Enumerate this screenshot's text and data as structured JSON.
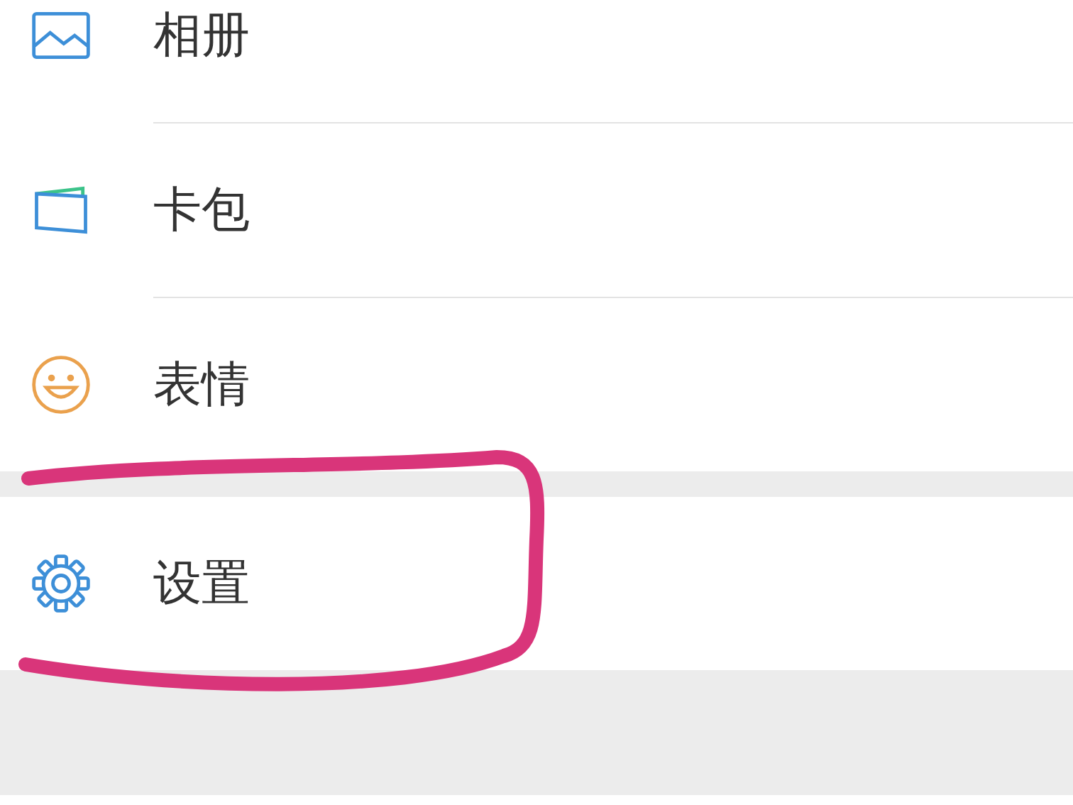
{
  "groups": [
    {
      "items": [
        {
          "kind": "album",
          "label": "相册"
        },
        {
          "kind": "wallet",
          "label": "卡包"
        },
        {
          "kind": "smiley",
          "label": "表情"
        }
      ]
    },
    {
      "items": [
        {
          "kind": "settings",
          "label": "设置"
        }
      ]
    }
  ],
  "annotation": {
    "kind": "circle",
    "color": "#d9357a"
  }
}
